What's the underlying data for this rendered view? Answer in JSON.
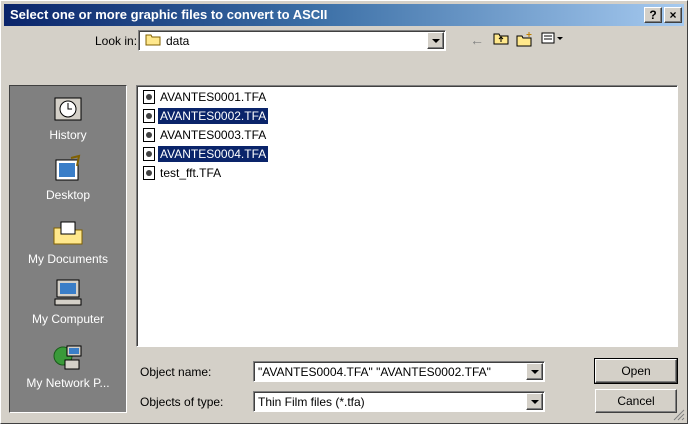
{
  "window": {
    "title": "Select one or more graphic files to convert to ASCII",
    "help_label": "?",
    "close_label": "×"
  },
  "lookin": {
    "label": "Look in:",
    "value": "data"
  },
  "places": [
    {
      "label": "History",
      "icon": "history-icon"
    },
    {
      "label": "Desktop",
      "icon": "desktop-icon"
    },
    {
      "label": "My Documents",
      "icon": "my-documents-icon"
    },
    {
      "label": "My Computer",
      "icon": "my-computer-icon"
    },
    {
      "label": "My Network P...",
      "icon": "network-places-icon"
    }
  ],
  "files": [
    {
      "name": "AVANTES0001.TFA",
      "selected": false
    },
    {
      "name": "AVANTES0002.TFA",
      "selected": true
    },
    {
      "name": "AVANTES0003.TFA",
      "selected": false
    },
    {
      "name": "AVANTES0004.TFA",
      "selected": true
    },
    {
      "name": "test_fft.TFA",
      "selected": false
    }
  ],
  "object_name": {
    "label": "Object name:",
    "value": "\"AVANTES0004.TFA\" \"AVANTES0002.TFA\""
  },
  "object_type": {
    "label": "Objects of type:",
    "value": "Thin Film files (*.tfa)"
  },
  "buttons": {
    "open": "Open",
    "cancel": "Cancel"
  },
  "colors": {
    "selection": "#0a246a",
    "face": "#d4d0c8",
    "places_bg": "#808080"
  }
}
